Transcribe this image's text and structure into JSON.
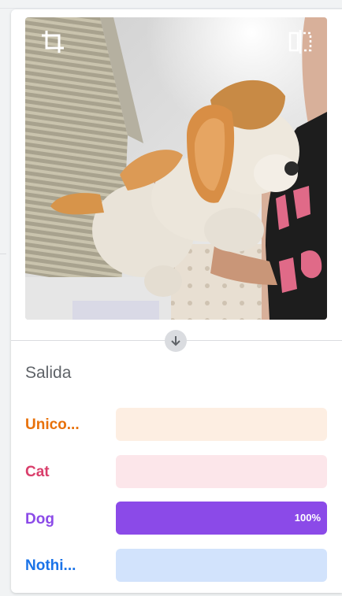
{
  "preview": {
    "crop_icon": "crop-icon",
    "flip_icon": "flip-horizontal-icon",
    "arrow_icon": "arrow-down-icon"
  },
  "output": {
    "title": "Salida",
    "classes": [
      {
        "label": "Unico...",
        "color": "#e8710a",
        "track": "#fdeee2",
        "confidence": 0,
        "percent_text": ""
      },
      {
        "label": "Cat",
        "color": "#d93e6b",
        "track": "#fce6ea",
        "confidence": 0,
        "percent_text": ""
      },
      {
        "label": "Dog",
        "color": "#8b4ae8",
        "track": "#efe6fc",
        "confidence": 1.0,
        "percent_text": "100%"
      },
      {
        "label": "Nothi...",
        "color": "#1a73e8",
        "track": "#d2e3fc",
        "confidence": 0,
        "percent_text": ""
      }
    ]
  }
}
